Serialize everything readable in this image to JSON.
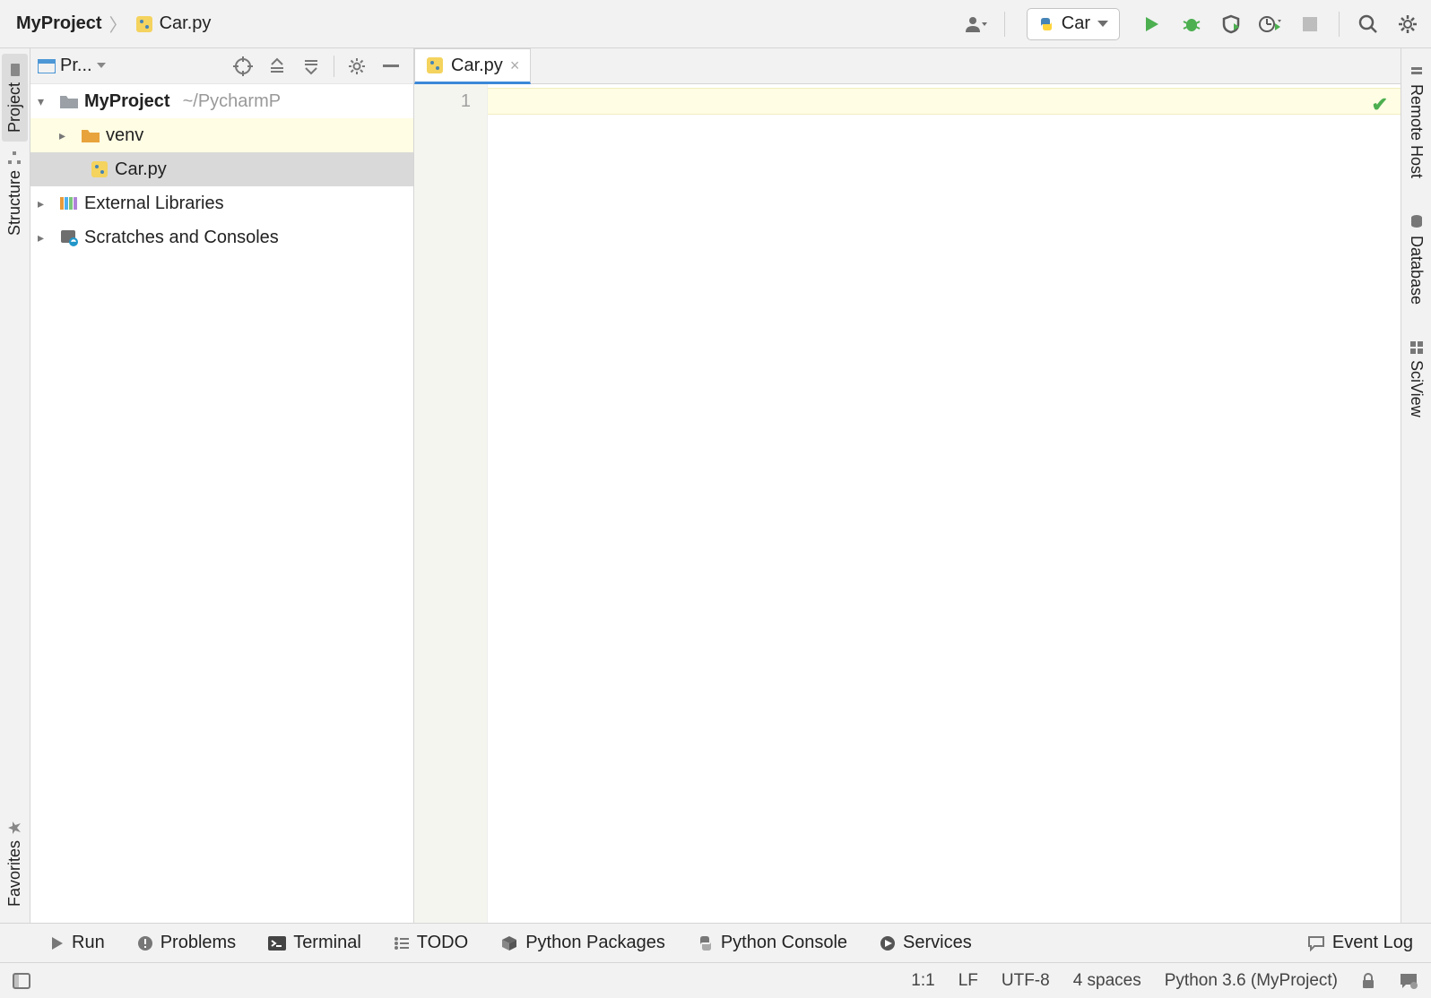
{
  "breadcrumb": {
    "project": "MyProject",
    "file": "Car.py"
  },
  "run_config": {
    "label": "Car"
  },
  "left_rail": {
    "project": "Project",
    "structure": "Structure",
    "favorites": "Favorites"
  },
  "proj_panel": {
    "title": "Pr..."
  },
  "tree": {
    "root": {
      "name": "MyProject",
      "path": "~/PycharmP"
    },
    "venv": "venv",
    "carfile": "Car.py",
    "ext_libs": "External Libraries",
    "scratches": "Scratches and Consoles"
  },
  "tab": {
    "label": "Car.py"
  },
  "editor": {
    "line_no": "1"
  },
  "right_rail": {
    "remote": "Remote Host",
    "database": "Database",
    "sciview": "SciView"
  },
  "bottom_bar": {
    "run": "Run",
    "problems": "Problems",
    "terminal": "Terminal",
    "todo": "TODO",
    "packages": "Python Packages",
    "console": "Python Console",
    "services": "Services",
    "eventlog": "Event Log"
  },
  "status": {
    "pos": "1:1",
    "lineend": "LF",
    "encoding": "UTF-8",
    "indent": "4 spaces",
    "interpreter": "Python 3.6 (MyProject)"
  }
}
